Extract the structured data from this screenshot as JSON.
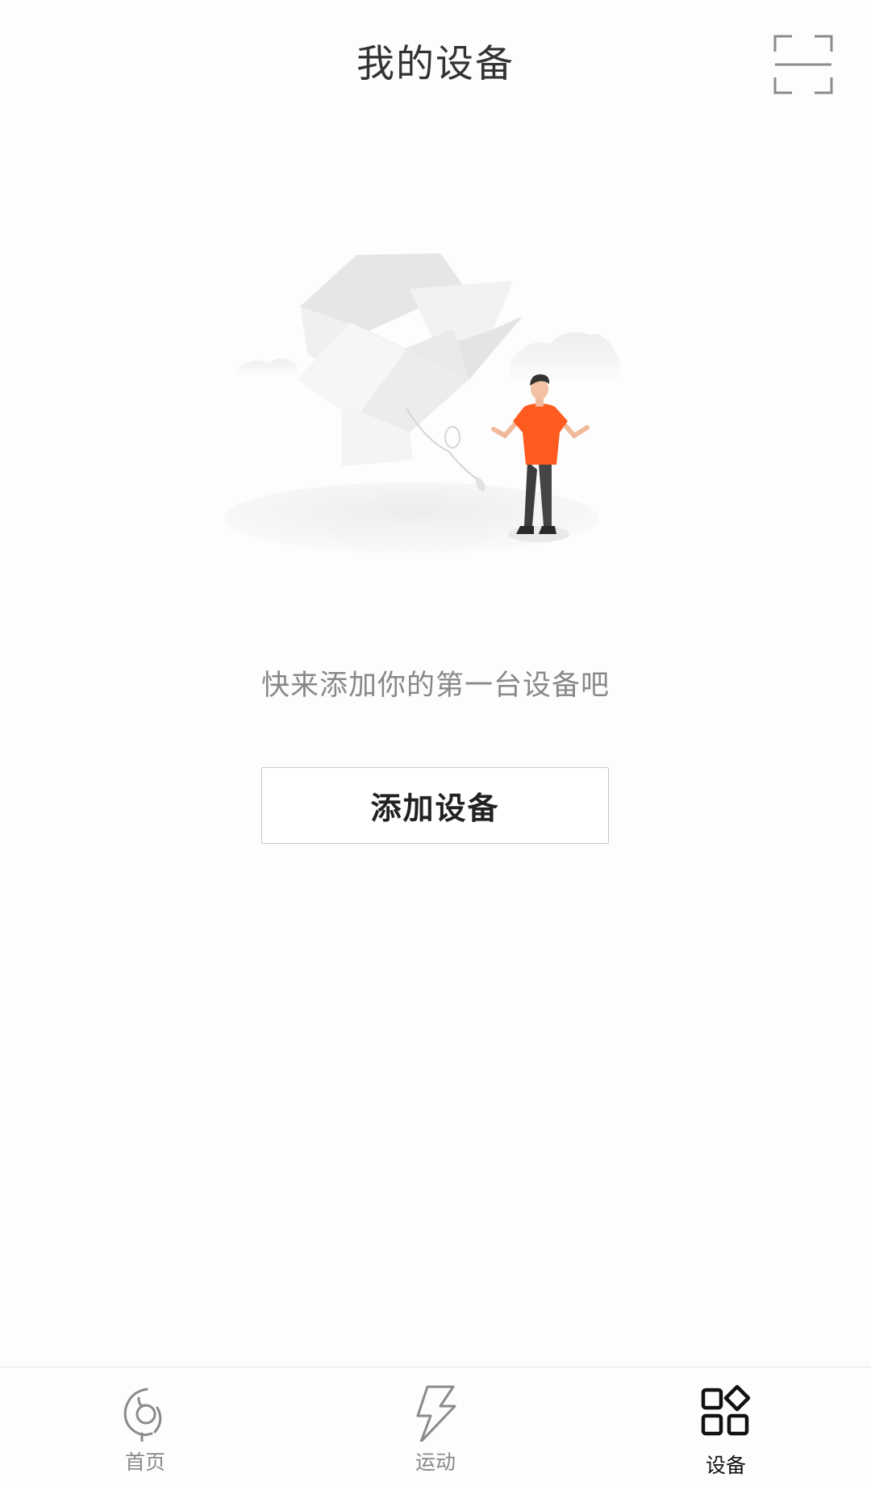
{
  "header": {
    "title": "我的设备",
    "scan_icon": "scan-frame-icon"
  },
  "empty_state": {
    "illustration": "empty-devices-illustration",
    "message": "快来添加你的第一台设备吧",
    "add_button_label": "添加设备"
  },
  "tabbar": {
    "items": [
      {
        "label": "首页",
        "icon": "home-icon",
        "active": false
      },
      {
        "label": "运动",
        "icon": "lightning-icon",
        "active": false
      },
      {
        "label": "设备",
        "icon": "devices-grid-icon",
        "active": true
      }
    ]
  },
  "colors": {
    "accent_shirt": "#ff5a1f",
    "text_primary": "#333333",
    "text_secondary": "#888888",
    "icon_inactive": "#8a8a8a",
    "icon_active": "#111111"
  }
}
